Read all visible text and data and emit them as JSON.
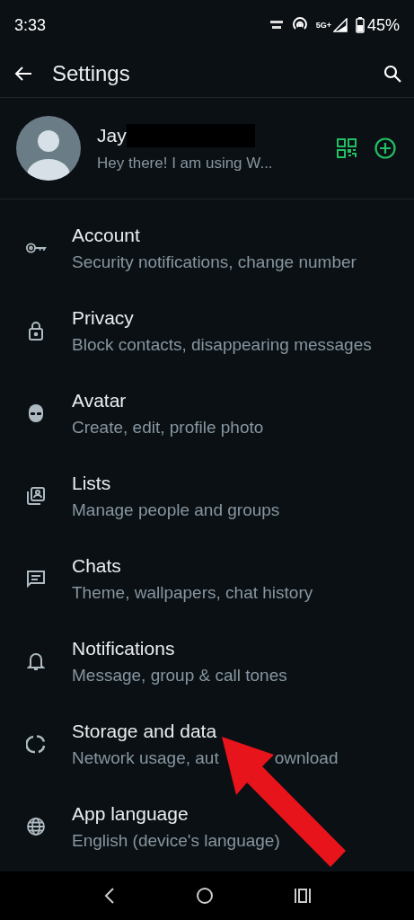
{
  "status_bar": {
    "time": "3:33",
    "network": "5G+",
    "battery": "45%"
  },
  "toolbar": {
    "title": "Settings"
  },
  "profile": {
    "name": "Jay",
    "status": "Hey there! I am using W..."
  },
  "items": [
    {
      "title": "Account",
      "subtitle": "Security notifications, change number"
    },
    {
      "title": "Privacy",
      "subtitle": "Block contacts, disappearing messages"
    },
    {
      "title": "Avatar",
      "subtitle": "Create, edit, profile photo"
    },
    {
      "title": "Lists",
      "subtitle": "Manage people and groups"
    },
    {
      "title": "Chats",
      "subtitle": "Theme, wallpapers, chat history"
    },
    {
      "title": "Notifications",
      "subtitle": "Message, group & call tones"
    },
    {
      "title": "Storage and data",
      "subtitle": "Network usage, aut",
      "subtitle_tail": "ownload"
    },
    {
      "title": "App language",
      "subtitle": "English (device's language)"
    }
  ]
}
